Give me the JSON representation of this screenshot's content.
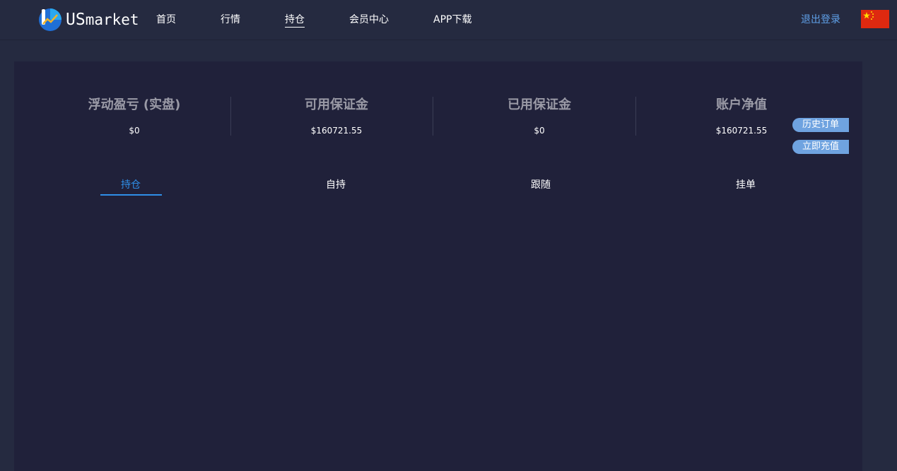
{
  "header": {
    "logo_text_prefix": "US",
    "logo_text_rest": "market",
    "nav": [
      "首页",
      "行情",
      "持仓",
      "会员中心",
      "APP下载"
    ],
    "active_nav": "持仓",
    "logout_label": "退出登录",
    "language": "china-flag-icon"
  },
  "stats": [
    {
      "title": "浮动盈亏 (实盘)",
      "value": "$0"
    },
    {
      "title": "可用保证金",
      "value": "$160721.55"
    },
    {
      "title": "已用保证金",
      "value": "$0"
    },
    {
      "title": "账户净值",
      "value": "$160721.55"
    }
  ],
  "side_buttons": {
    "history": "历史订单",
    "deposit": "立即充值"
  },
  "tabs": [
    "持仓",
    "自持",
    "跟随",
    "挂单"
  ],
  "active_tab": "持仓",
  "colors": {
    "background": "#252a40",
    "panel": "#20213a",
    "accent": "#2f8fe8",
    "button": "#6fa3e0",
    "flag_red": "#de2910",
    "flag_star": "#ffde00"
  }
}
